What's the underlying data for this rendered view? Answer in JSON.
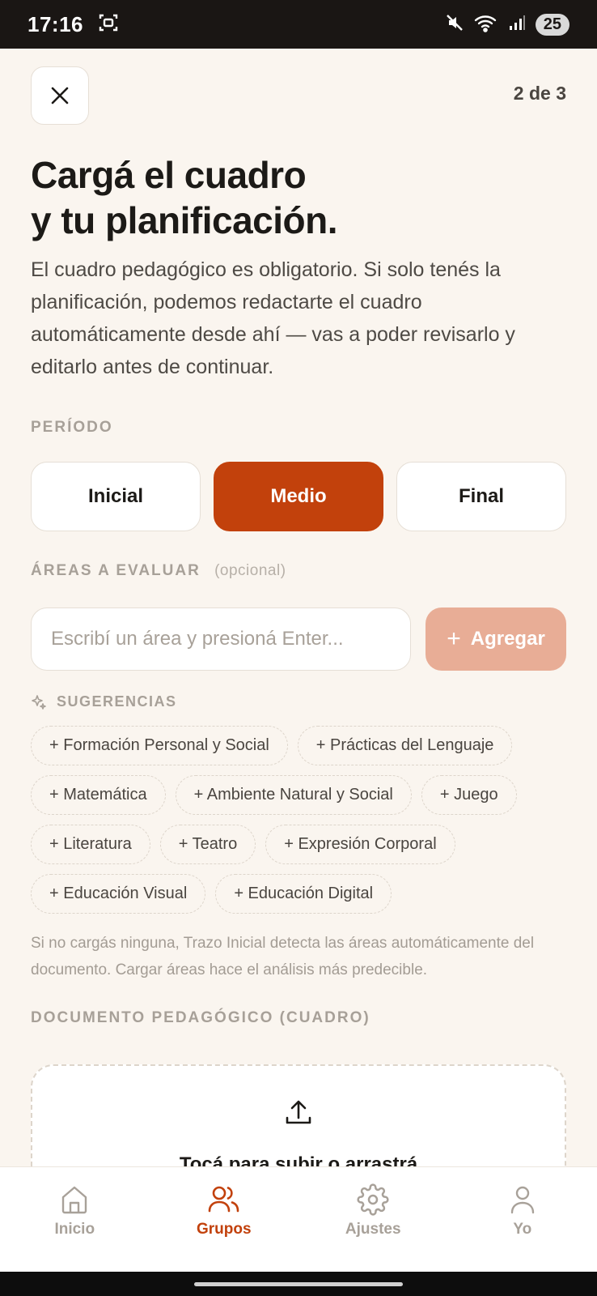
{
  "status_bar": {
    "time": "17:16",
    "battery": "25"
  },
  "header": {
    "step": "2 de 3"
  },
  "title": {
    "line1": "Cargá el cuadro",
    "line2": "y tu planificación."
  },
  "description": "El cuadro pedagógico es obligatorio. Si solo tenés la planificación, podemos redactarte el cuadro automáticamente desde ahí — vas a poder revisarlo y editarlo antes de continuar.",
  "period": {
    "label": "PERÍODO",
    "options": [
      "Inicial",
      "Medio",
      "Final"
    ],
    "selected": "Medio"
  },
  "areas": {
    "label": "ÁREAS A EVALUAR",
    "optional": "(opcional)",
    "input_placeholder": "Escribí un área y presioná Enter...",
    "input_value": "",
    "add_label": "Agregar"
  },
  "suggestions": {
    "label": "SUGERENCIAS",
    "items": [
      "+ Formación Personal y Social",
      "+ Prácticas del Lenguaje",
      "+ Matemática",
      "+ Ambiente Natural y Social",
      "+ Juego",
      "+ Literatura",
      "+ Teatro",
      "+ Expresión Corporal",
      "+ Educación Visual",
      "+ Educación Digital"
    ]
  },
  "hint": "Si no cargás ninguna, Trazo Inicial detecta las áreas automáticamente del documento. Cargar áreas hace el análisis más predecible.",
  "document": {
    "label": "DOCUMENTO PEDAGÓGICO (CUADRO)",
    "upload_text": "Tocá para subir o arrastrá"
  },
  "tabs": [
    {
      "label": "Inicio",
      "icon": "home-icon"
    },
    {
      "label": "Grupos",
      "icon": "users-icon"
    },
    {
      "label": "Ajustes",
      "icon": "gear-icon"
    },
    {
      "label": "Yo",
      "icon": "user-icon"
    }
  ],
  "active_tab": "Grupos",
  "colors": {
    "accent": "#c2410c",
    "accent_light": "#e8ad96",
    "background": "#faf5ef"
  }
}
